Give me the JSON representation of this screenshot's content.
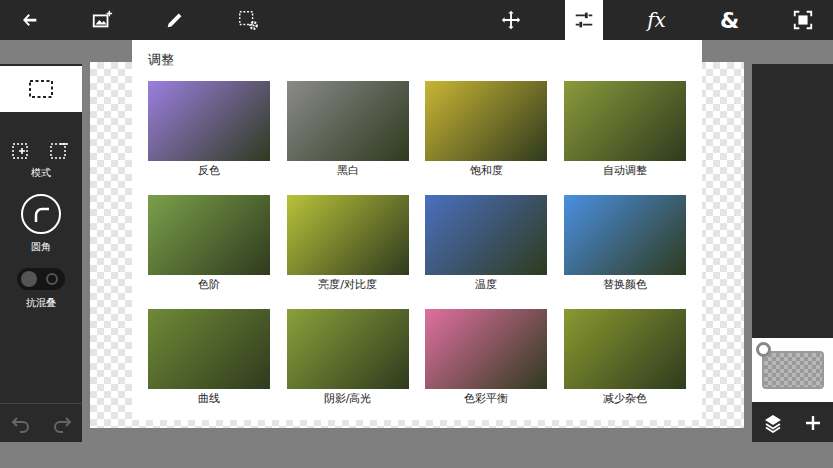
{
  "toolbar": {
    "tools": [
      {
        "kind": "icon",
        "selected": false
      },
      {
        "kind": "icon",
        "selected": false
      },
      {
        "kind": "icon",
        "selected": false
      },
      {
        "kind": "icon",
        "selected": false
      },
      {
        "kind": "icon",
        "selected": false
      },
      {
        "kind": "icon",
        "selected": true
      },
      {
        "kind": "text",
        "label": "fx",
        "selected": false
      },
      {
        "kind": "text",
        "label": "&",
        "selected": false
      },
      {
        "kind": "icon",
        "selected": false
      }
    ]
  },
  "left_panel": {
    "shape": {
      "selected": true
    },
    "mode": {
      "label": "模式"
    },
    "corner": {
      "label": "圆角"
    },
    "antialias": {
      "label": "抗混叠",
      "on": false
    },
    "history": {
      "undo_disabled": true,
      "redo_disabled": true
    }
  },
  "adjust_panel": {
    "title": "调整",
    "items": [
      {
        "label": "反色",
        "color": "#9b7fe0"
      },
      {
        "label": "黑白",
        "color": "#8a8a8a"
      },
      {
        "label": "饱和度",
        "color": "#c9b534"
      },
      {
        "label": "自动调整",
        "color": "#8a9a3a"
      },
      {
        "label": "色阶",
        "color": "#7aa04a"
      },
      {
        "label": "亮度/对比度",
        "color": "#b8c23a"
      },
      {
        "label": "温度",
        "color": "#4a70c0"
      },
      {
        "label": "替换颜色",
        "color": "#4a90e0"
      },
      {
        "label": "曲线",
        "color": "#6f8a36"
      },
      {
        "label": "阴影/高光",
        "color": "#8aa03a"
      },
      {
        "label": "色彩平衡",
        "color": "#e070a0"
      },
      {
        "label": "减少杂色",
        "color": "#8a9a30"
      }
    ]
  },
  "right_panel": {
    "layers": [
      {
        "selected": true
      }
    ]
  }
}
